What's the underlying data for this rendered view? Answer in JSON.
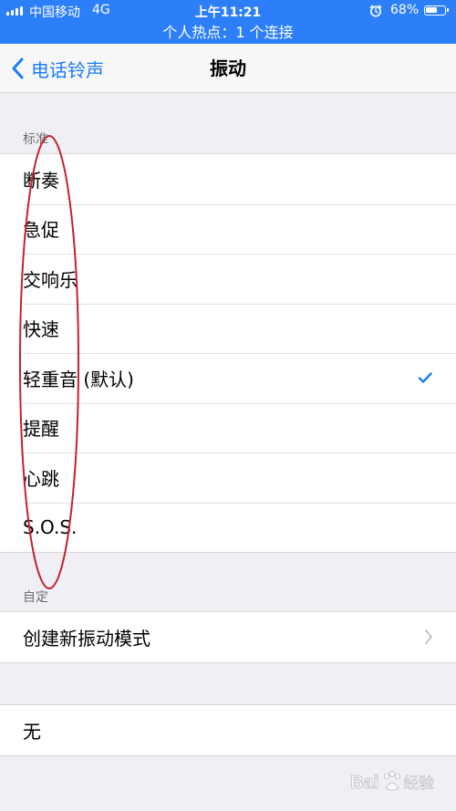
{
  "status_bar": {
    "carrier": "中国移动",
    "network": "4G",
    "time": "上午11:21",
    "battery": "68%",
    "battery_level": 0.68,
    "hotspot_banner": "个人热点：1 个连接"
  },
  "nav": {
    "back_label": "电话铃声",
    "title": "振动"
  },
  "standard": {
    "header": "标准",
    "items": [
      {
        "label": "断奏",
        "selected": false
      },
      {
        "label": "急促",
        "selected": false
      },
      {
        "label": "交响乐",
        "selected": false
      },
      {
        "label": "快速",
        "selected": false
      },
      {
        "label": "轻重音 (默认)",
        "selected": true
      },
      {
        "label": "提醒",
        "selected": false
      },
      {
        "label": "心跳",
        "selected": false
      },
      {
        "label": "S.O.S.",
        "selected": false
      }
    ]
  },
  "custom": {
    "header": "自定",
    "create_label": "创建新振动模式"
  },
  "none_option": {
    "label": "无"
  },
  "colors": {
    "accent": "#1a7cf5",
    "status_bar": "#2d7ff9",
    "annotation": "#c0242c"
  },
  "watermark": {
    "text": "Bai 经验"
  }
}
